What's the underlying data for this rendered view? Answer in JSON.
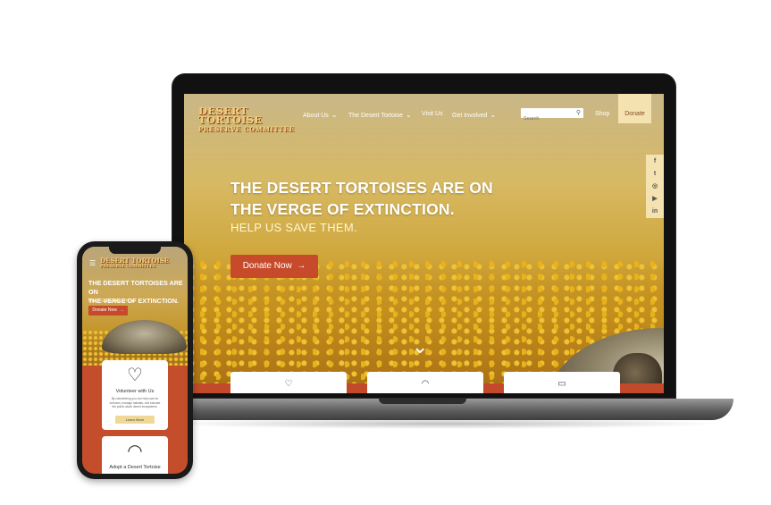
{
  "laptop": {
    "logo": {
      "line1": "DESERT TORTOISE",
      "line2": "PRESERVE COMMITTEE"
    },
    "nav": [
      {
        "label": "About Us",
        "has_dropdown": true
      },
      {
        "label": "The Desert Tortoise",
        "has_dropdown": true
      },
      {
        "label": "Visit Us",
        "has_dropdown": false
      },
      {
        "label": "Get Involved",
        "has_dropdown": true
      }
    ],
    "search": {
      "placeholder": "Search",
      "icon": "search-icon"
    },
    "shop_label": "Shop",
    "donate_label": "Donate",
    "social": [
      "facebook-icon",
      "twitter-icon",
      "instagram-icon",
      "youtube-icon",
      "linkedin-icon"
    ],
    "hero": {
      "heading_line1": "THE DESERT TORTOISES ARE ON",
      "heading_line2": "THE VERGE OF EXTINCTION.",
      "subheading": "HELP US SAVE THEM.",
      "donate_button": "Donate Now",
      "scroll_icon": "chevron-down-icon"
    },
    "cards": [
      "heart-hands-icon",
      "tortoise-icon",
      "sign-icon"
    ],
    "colors": {
      "accent": "#c74a2a",
      "cream": "#f4e3b0",
      "logo": "#f3d07a"
    }
  },
  "phone": {
    "logo": {
      "line1": "DESERT TORTOISE",
      "line2": "PRESERVE COMMITTEE"
    },
    "menu_icon": "hamburger-icon",
    "hero": {
      "heading_line1": "THE DESERT TORTOISES ARE ON",
      "heading_line2": "THE VERGE OF EXTINCTION.",
      "subheading": "HELP US SAVE THEM.",
      "donate_button": "Donate Now"
    },
    "card1": {
      "icon": "heart-hands-icon",
      "title": "Volunteer with Us",
      "description": "By volunteering you can help care for tortoises, manage habitats, and educate the public about desert ecosystems.",
      "button": "Learn More"
    },
    "card2": {
      "icon": "tortoise-icon",
      "title": "Adopt a Desert Tortoise"
    }
  }
}
